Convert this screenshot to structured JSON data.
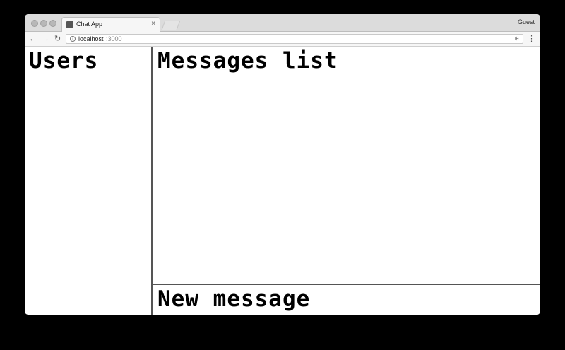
{
  "browser": {
    "tab_title": "Chat App",
    "tab_close": "×",
    "profile_label": "Guest",
    "url_host": "localhost",
    "url_port": ":3000",
    "info_icon": "i",
    "zoom_icon": "⊕",
    "menu_icon": "⋮",
    "back_icon": "←",
    "forward_icon": "→",
    "reload_icon": "↻"
  },
  "app": {
    "users_heading": "Users",
    "messages_heading": "Messages list",
    "new_message_heading": "New message"
  }
}
